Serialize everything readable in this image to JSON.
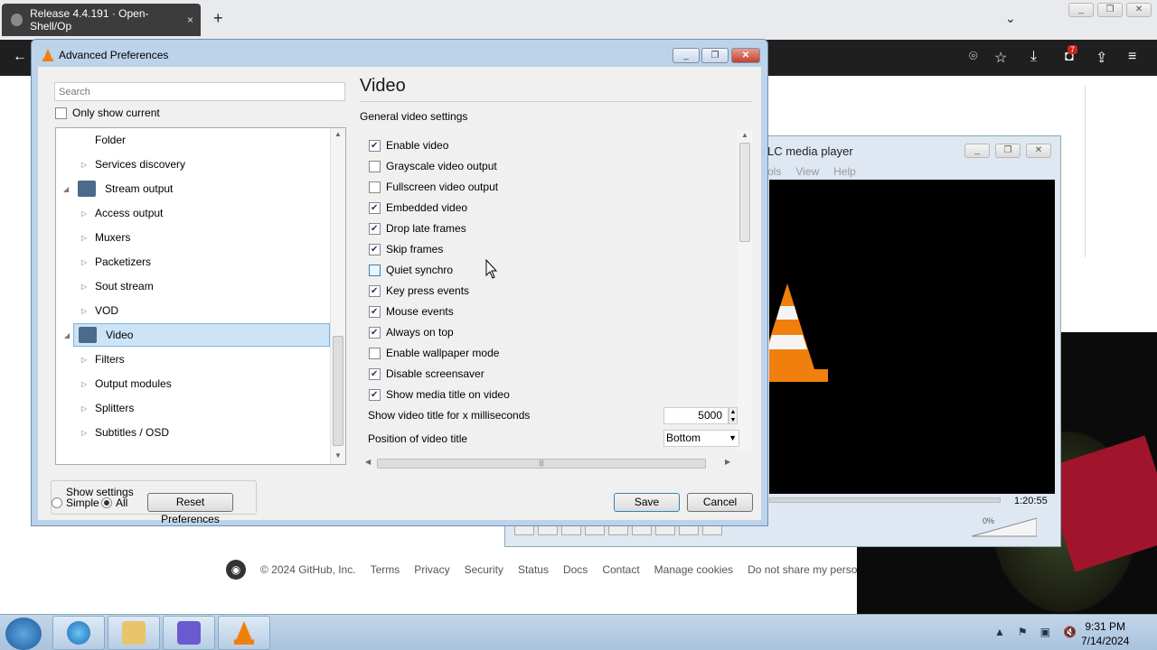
{
  "browser": {
    "tab_title": "Release 4.4.191 · Open-Shell/Op",
    "tab_close": "×",
    "new_tab": "+",
    "tab_list": "⌄",
    "badge": "7",
    "toolbar_icons": [
      "back-arrow-icon",
      "fingerprint-icon",
      "star-icon",
      "download-icon",
      "extension-icon",
      "share-icon",
      "menu-icon"
    ]
  },
  "github_footer": {
    "copyright": "© 2024 GitHub, Inc.",
    "links": [
      "Terms",
      "Privacy",
      "Security",
      "Status",
      "Docs",
      "Contact",
      "Manage cookies",
      "Do not share my personal"
    ]
  },
  "vlc_player": {
    "title": "LC media player",
    "menu": [
      "ols",
      "View",
      "Help"
    ],
    "time": "1:20:55",
    "volume": "0%"
  },
  "dialog": {
    "title": "Advanced Preferences",
    "search_placeholder": "Search",
    "only_show_current": "Only show current",
    "tree": [
      {
        "label": "Folder",
        "level": 1,
        "expand": "",
        "selected": false
      },
      {
        "label": "Services discovery",
        "level": 1,
        "expand": "collapsed",
        "selected": false
      },
      {
        "label": "Stream output",
        "level": 0,
        "expand": "expanded",
        "selected": false
      },
      {
        "label": "Access output",
        "level": 1,
        "expand": "collapsed",
        "selected": false
      },
      {
        "label": "Muxers",
        "level": 1,
        "expand": "collapsed",
        "selected": false
      },
      {
        "label": "Packetizers",
        "level": 1,
        "expand": "collapsed",
        "selected": false
      },
      {
        "label": "Sout stream",
        "level": 1,
        "expand": "collapsed",
        "selected": false
      },
      {
        "label": "VOD",
        "level": 1,
        "expand": "collapsed",
        "selected": false
      },
      {
        "label": "Video",
        "level": 0,
        "expand": "expanded",
        "selected": true
      },
      {
        "label": "Filters",
        "level": 1,
        "expand": "collapsed",
        "selected": false
      },
      {
        "label": "Output modules",
        "level": 1,
        "expand": "collapsed",
        "selected": false
      },
      {
        "label": "Splitters",
        "level": 1,
        "expand": "collapsed",
        "selected": false
      },
      {
        "label": "Subtitles / OSD",
        "level": 1,
        "expand": "collapsed",
        "selected": false
      }
    ],
    "show_settings_label": "Show settings",
    "simple_label": "Simple",
    "all_label": "All",
    "show_settings_selected": "All",
    "reset_label": "Reset Preferences",
    "save_label": "Save",
    "cancel_label": "Cancel",
    "panel_title": "Video",
    "section_label": "General video settings",
    "options": [
      {
        "label": "Enable video",
        "checked": true
      },
      {
        "label": "Grayscale video output",
        "checked": false
      },
      {
        "label": "Fullscreen video output",
        "checked": false
      },
      {
        "label": "Embedded video",
        "checked": true
      },
      {
        "label": "Drop late frames",
        "checked": true
      },
      {
        "label": "Skip frames",
        "checked": true
      },
      {
        "label": "Quiet synchro",
        "checked": false
      },
      {
        "label": "Key press events",
        "checked": true
      },
      {
        "label": "Mouse events",
        "checked": true
      },
      {
        "label": "Always on top",
        "checked": true
      },
      {
        "label": "Enable wallpaper mode",
        "checked": false
      },
      {
        "label": "Disable screensaver",
        "checked": true
      },
      {
        "label": "Show media title on video",
        "checked": true
      }
    ],
    "show_title_ms_label": "Show video title for x milliseconds",
    "show_title_ms_value": "5000",
    "position_label": "Position of video title",
    "position_value": "Bottom"
  },
  "taskbar": {
    "time": "9:31 PM",
    "date": "7/14/2024"
  }
}
